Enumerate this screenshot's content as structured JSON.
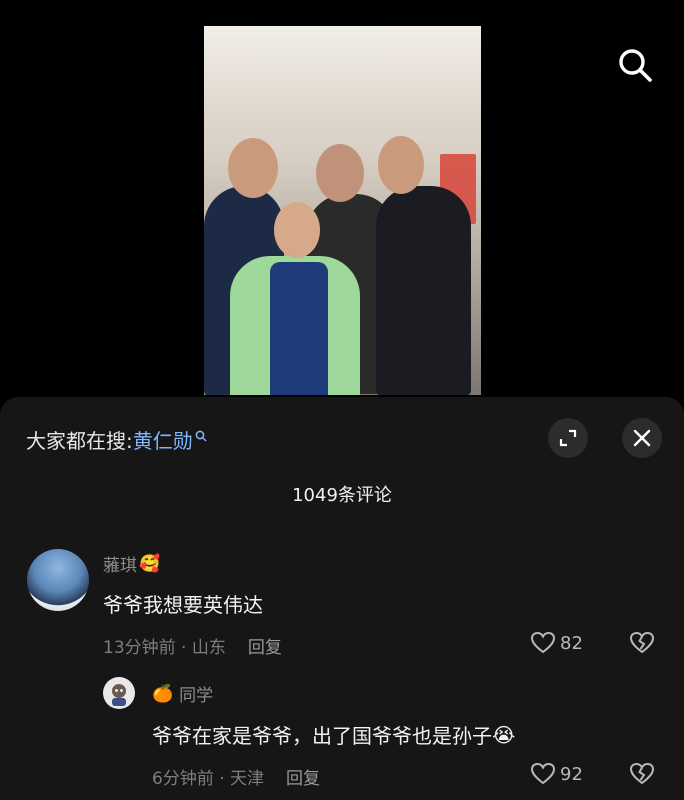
{
  "trending": {
    "prefix": "大家都在搜:",
    "term": "黄仁勋"
  },
  "comments_count": "1049条评论",
  "comments": [
    {
      "username": "蕥琪",
      "emoji": "🥰",
      "text": "爷爷我想要英伟达",
      "meta": "13分钟前 · 山东",
      "reply": "回复",
      "likes": "82"
    },
    {
      "username": "同学",
      "prefix_emoji": "🍊",
      "text": "爷爷在家是爷爷，出了国爷爷也是孙子",
      "emoji": "😭",
      "meta": "6分钟前 · 天津",
      "reply": "回复",
      "likes": "92"
    }
  ],
  "colors": {
    "accent_link": "#7fb6ff",
    "sheet_bg": "#161616",
    "muted_text": "#8c8c8c"
  },
  "icons": [
    "search-icon",
    "expand-icon",
    "close-icon",
    "heart-icon",
    "broken-heart-icon"
  ]
}
